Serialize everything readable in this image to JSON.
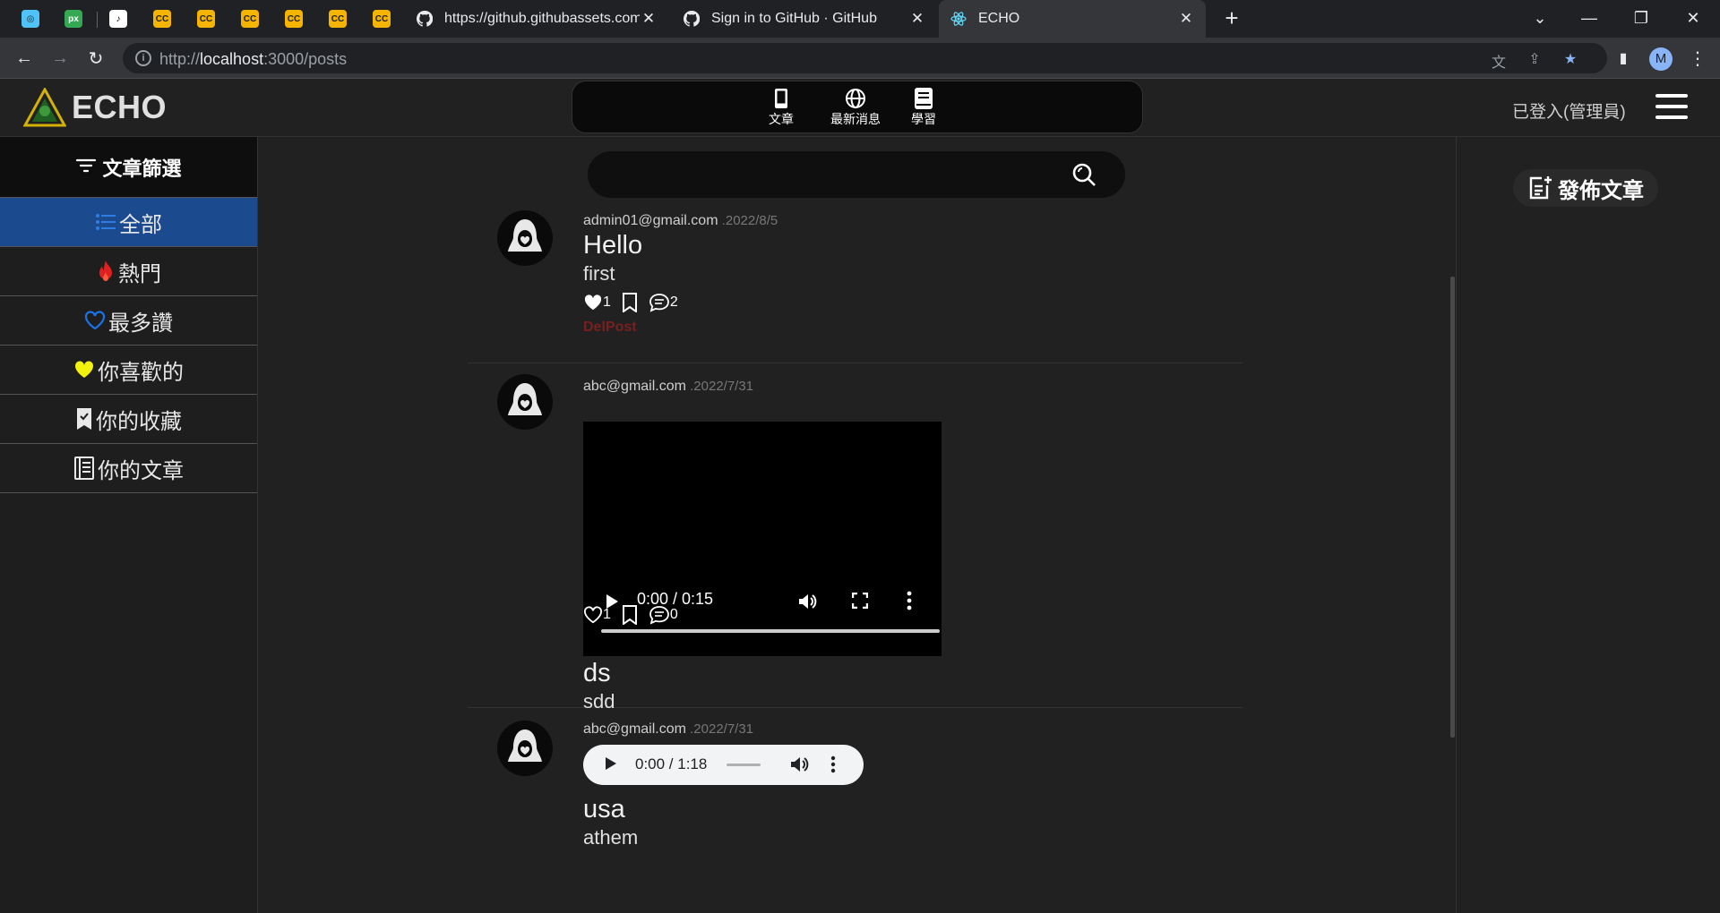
{
  "browser": {
    "tabs": [
      {
        "title": "https://github.githubassets.com",
        "active": false
      },
      {
        "title": "Sign in to GitHub · GitHub",
        "active": false
      },
      {
        "title": "ECHO",
        "active": true
      }
    ],
    "url_prefix": "http://",
    "url_host": "localhost",
    "url_rest": ":3000/posts",
    "profile_initial": "M"
  },
  "app": {
    "logo_text": "ECHO",
    "topnav": [
      {
        "label": "文章",
        "icon": "phone-icon"
      },
      {
        "label": "最新消息",
        "icon": "globe-icon"
      },
      {
        "label": "學習",
        "icon": "book-icon"
      }
    ],
    "login_status": "已登入(管理員)",
    "filter_title": "文章篩選",
    "filters": [
      {
        "label": "全部",
        "icon": "list-icon",
        "active": true
      },
      {
        "label": "熱門",
        "icon": "fire-icon",
        "active": false
      },
      {
        "label": "最多讚",
        "icon": "heart-outline-icon",
        "active": false
      },
      {
        "label": "你喜歡的",
        "icon": "heart-filled-icon",
        "active": false
      },
      {
        "label": "你的收藏",
        "icon": "bookmark-icon",
        "active": false
      },
      {
        "label": "你的文章",
        "icon": "document-icon",
        "active": false
      }
    ],
    "publish_label": "發佈文章",
    "search_placeholder": ""
  },
  "posts": [
    {
      "author": "admin01@gmail.com",
      "date": " .2022/8/5",
      "title": "Hello",
      "body": "first",
      "likes": "1",
      "comments": "2",
      "delete_label": "DelPost",
      "media": "none"
    },
    {
      "author": "abc@gmail.com",
      "date": " .2022/7/31",
      "title": "ds",
      "body": "sdd",
      "likes": "1",
      "comments": "0",
      "media": "video",
      "media_time": "0:00 / 0:15"
    },
    {
      "author": "abc@gmail.com",
      "date": " .2022/7/31",
      "title": "usa",
      "body": "athem",
      "media": "audio",
      "media_time": "0:00 / 1:18"
    }
  ],
  "colors": {
    "active_filter_bg": "#1c4a8f",
    "fire": "#e02020",
    "heart_outline": "#1a73e8",
    "heart_filled": "#f2f20a",
    "delete": "#7a1f1f"
  }
}
